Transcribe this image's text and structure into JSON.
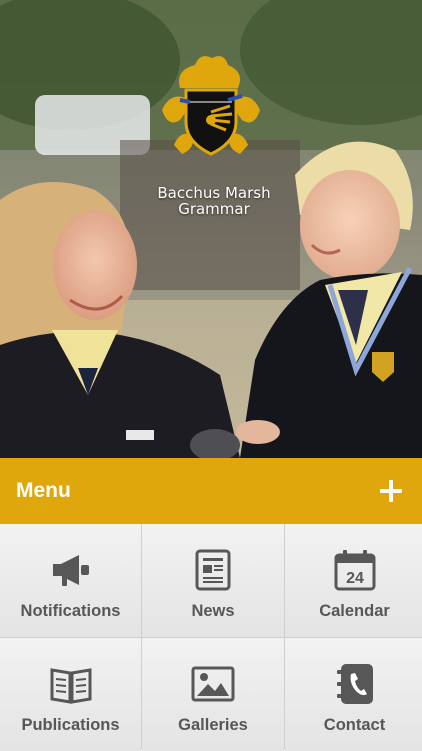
{
  "header": {
    "school_name_line1": "Bacchus Marsh",
    "school_name_line2": "Grammar",
    "photo": "students-photo",
    "crest": "school-crest"
  },
  "menu": {
    "label": "Menu",
    "expand_icon": "plus-icon",
    "accent_color": "#dfa70c"
  },
  "tiles": [
    {
      "label": "Notifications",
      "icon": "megaphone-icon"
    },
    {
      "label": "News",
      "icon": "newspaper-icon"
    },
    {
      "label": "Calendar",
      "icon": "calendar-icon",
      "icon_text": "24"
    },
    {
      "label": "Publications",
      "icon": "book-icon"
    },
    {
      "label": "Galleries",
      "icon": "image-icon"
    },
    {
      "label": "Contact",
      "icon": "address-book-icon"
    }
  ]
}
